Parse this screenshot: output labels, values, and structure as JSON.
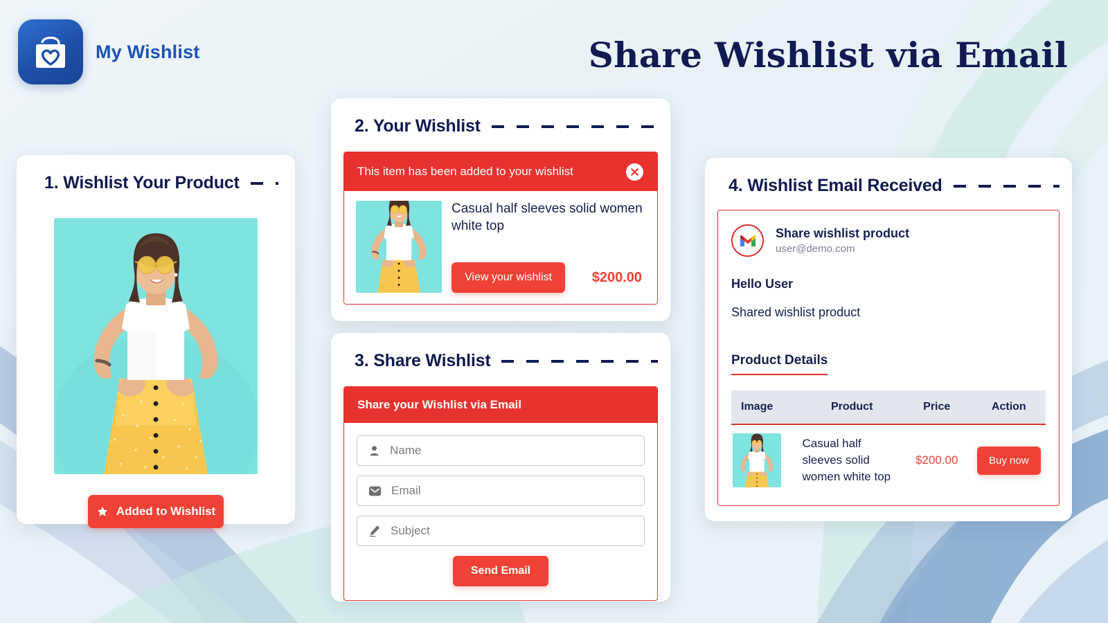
{
  "brand": {
    "name": "My Wishlist",
    "logo_icon": "shopping-bag-heart-icon",
    "logo_color": "#1e4fa8"
  },
  "page": {
    "title": "Share Wishlist via Email",
    "title_color": "#111a52",
    "accent_red": "#ef4136",
    "alert_red": "#e8322e",
    "navy": "#16204f"
  },
  "product": {
    "name": "Casual half sleeves solid women white top",
    "price": "$200.00",
    "image_alt": "woman-white-top-yellow-skirt-photo"
  },
  "card1": {
    "step_title": "1. Wishlist Your Product",
    "button_label": "Added to Wishlist",
    "button_icon": "star-icon"
  },
  "card2": {
    "step_title": "2. Your Wishlist",
    "alert_text": "This item has been added to your wishlist",
    "close_icon": "close-icon",
    "product_name": "Casual half sleeves solid women white top",
    "view_button_label": "View your wishlist",
    "price": "$200.00"
  },
  "card3": {
    "step_title": "3. Share Wishlist",
    "form_header": "Share your Wishlist via Email",
    "fields": [
      {
        "placeholder": "Name",
        "value": "",
        "icon": "user-icon"
      },
      {
        "placeholder": "Email",
        "value": "",
        "icon": "envelope-icon"
      },
      {
        "placeholder": "Subject",
        "value": "",
        "icon": "pencil-icon"
      }
    ],
    "submit_label": "Send Email"
  },
  "card4": {
    "step_title": "4. Wishlist Email Received",
    "mail_icon": "gmail-icon",
    "mail_subject": "Share wishlist product",
    "mail_address": "user@demo.com",
    "greeting": "Hello User",
    "body_text": "Shared wishlist product",
    "details_title": "Product Details",
    "table": {
      "columns": [
        "Image",
        "Product",
        "Price",
        "Action"
      ],
      "rows": [
        {
          "image": "woman-white-top-yellow-skirt-photo",
          "product": "Casual half sleeves solid women white top",
          "price": "$200.00",
          "action_label": "Buy now"
        }
      ]
    }
  }
}
